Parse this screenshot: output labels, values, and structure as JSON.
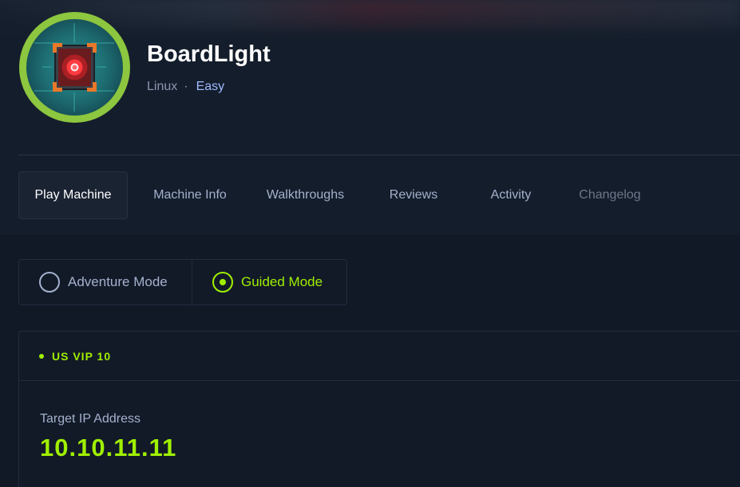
{
  "machine": {
    "name": "BoardLight",
    "os": "Linux",
    "separator": "·",
    "difficulty": "Easy",
    "avatar_icon": "machine-chip-icon"
  },
  "tabs": [
    {
      "label": "Play Machine",
      "active": true
    },
    {
      "label": "Machine Info",
      "active": false
    },
    {
      "label": "Walkthroughs",
      "active": false
    },
    {
      "label": "Reviews",
      "active": false
    },
    {
      "label": "Activity",
      "active": false
    },
    {
      "label": "Changelog",
      "active": false,
      "muted": true
    }
  ],
  "modes": {
    "adventure": {
      "label": "Adventure Mode",
      "selected": false
    },
    "guided": {
      "label": "Guided Mode",
      "selected": true
    }
  },
  "vpn": {
    "server": "US VIP 10",
    "status_color": "#9fef00"
  },
  "target": {
    "label": "Target IP Address",
    "ip": "10.10.11.11"
  },
  "colors": {
    "accent": "#9fef00",
    "background": "#141d2b",
    "avatar_ring": "#8dc63f",
    "difficulty": "#9fbaff"
  }
}
